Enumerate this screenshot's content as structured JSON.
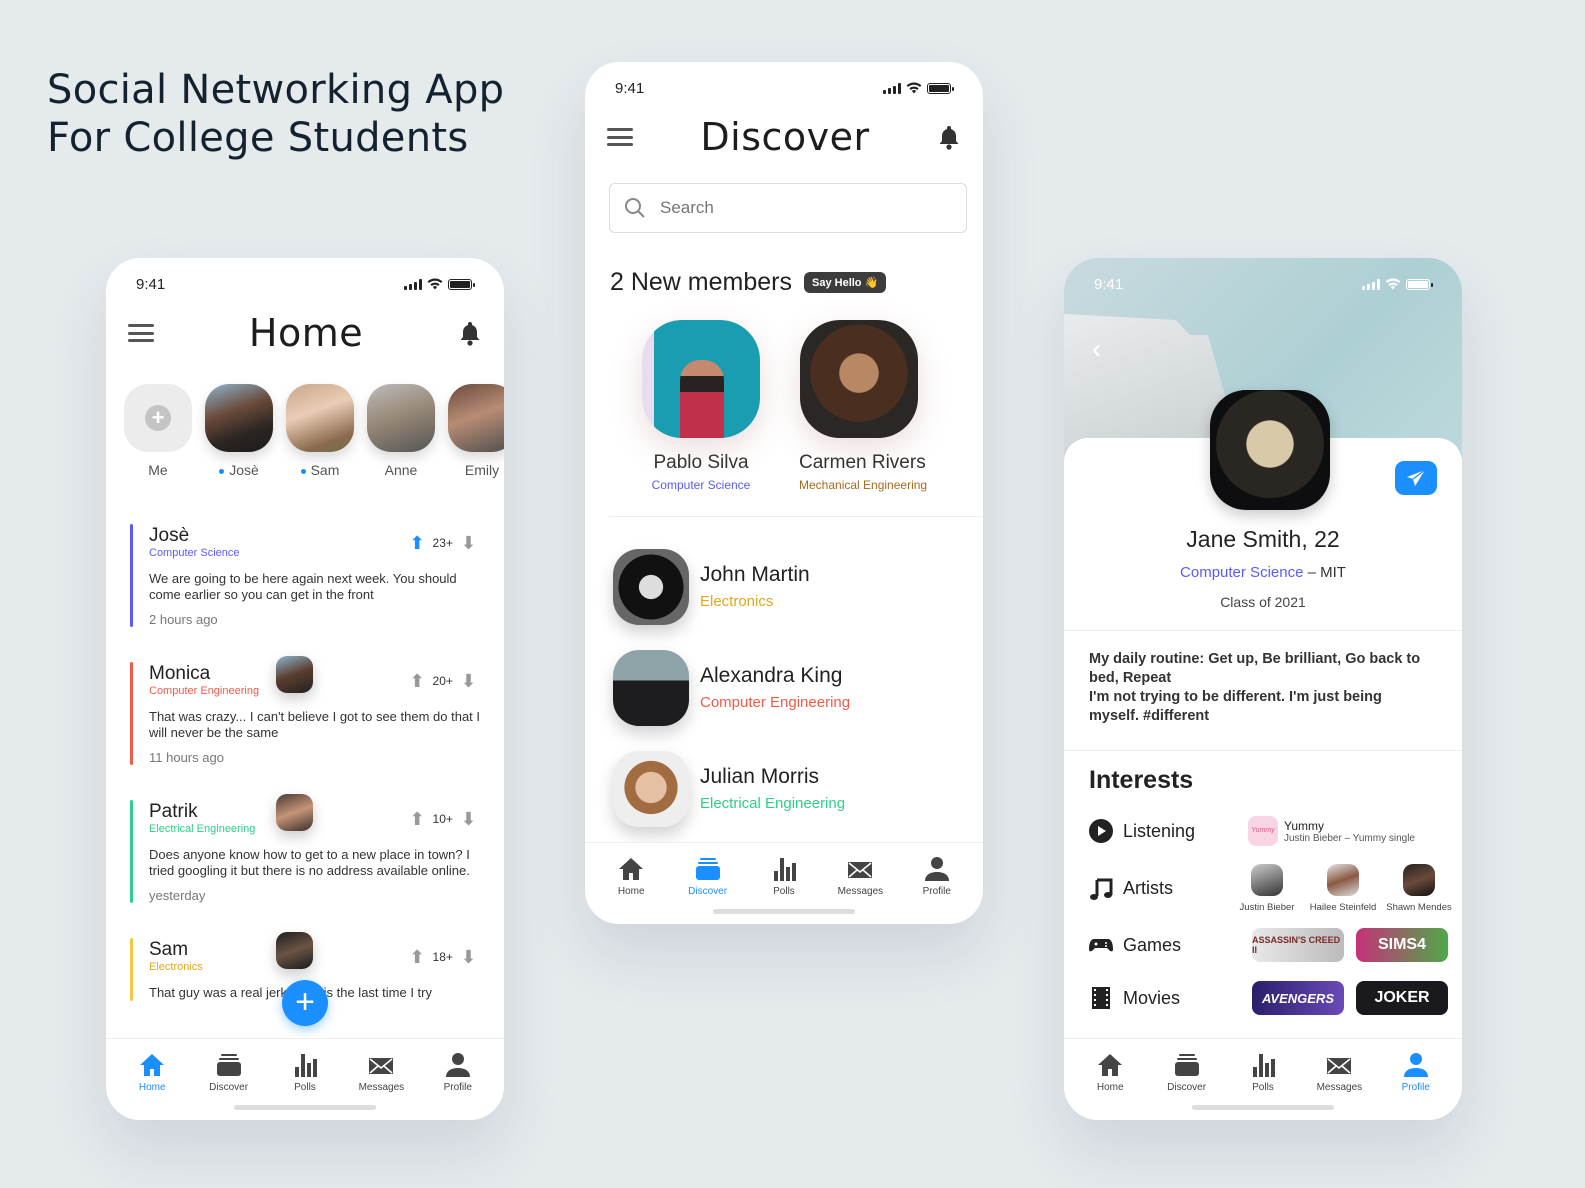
{
  "headline": {
    "line1": "Social Networking App",
    "line2": "For College Students"
  },
  "status_time": "9:41",
  "colors": {
    "accent": "#1c8fff",
    "cs": "#5b5bf5",
    "ce": "#f25a47",
    "ee": "#2ecf8a",
    "el": "#e0a81c",
    "me": "#a86a1e"
  },
  "nav": [
    {
      "label": "Home",
      "icon": "home-icon"
    },
    {
      "label": "Discover",
      "icon": "cards-icon"
    },
    {
      "label": "Polls",
      "icon": "bar-chart-icon"
    },
    {
      "label": "Messages",
      "icon": "envelope-icon"
    },
    {
      "label": "Profile",
      "icon": "person-icon"
    }
  ],
  "home": {
    "title": "Home",
    "stories": [
      {
        "name": "Me",
        "online": false
      },
      {
        "name": "Josè",
        "online": true
      },
      {
        "name": "Sam",
        "online": true
      },
      {
        "name": "Anne",
        "online": false
      },
      {
        "name": "Emily",
        "online": false
      }
    ],
    "posts": [
      {
        "name": "Josè",
        "major": "Computer Science",
        "votes": "23+",
        "upvoted": true,
        "text": "We are going to be here again next week. You should come earlier so you can get in the front",
        "time": "2 hours ago"
      },
      {
        "name": "Monica",
        "major": "Computer Engineering",
        "votes": "20+",
        "upvoted": false,
        "text": "That was crazy... I can't believe I got to see them do that I will never be the same",
        "time": "11 hours ago"
      },
      {
        "name": "Patrik",
        "major": "Electrical Engineering",
        "votes": "10+",
        "upvoted": false,
        "text": "Does anyone know how to get to a new place in town? I tried googling it but there is no address available online.",
        "time": "yesterday"
      },
      {
        "name": "Sam",
        "major": "Electronics",
        "votes": "18+",
        "upvoted": false,
        "text": "That guy was a real jerk. That is the last time I try",
        "time": ""
      }
    ],
    "fab": "+"
  },
  "discover": {
    "title": "Discover",
    "search_placeholder": "Search",
    "new_members_heading": "2 New members",
    "say_hello": "Say Hello 👋",
    "new_members": [
      {
        "name": "Pablo Silva",
        "major": "Computer Science"
      },
      {
        "name": "Carmen Rivers",
        "major": "Mechanical Engineering"
      }
    ],
    "members": [
      {
        "name": "John Martin",
        "major": "Electronics"
      },
      {
        "name": "Alexandra King",
        "major": "Computer Engineering"
      },
      {
        "name": "Julian Morris",
        "major": "Electrical Engineering"
      }
    ]
  },
  "profile": {
    "name": "Jane Smith, 22",
    "major": "Computer Science",
    "school": " – MIT",
    "class": "Class of 2021",
    "bio": "My daily routine: Get up, Be brilliant, Go back to bed, Repeat\nI'm not trying to be different. I'm just being myself. #different",
    "interests_heading": "Interests",
    "listening": {
      "label": "Listening",
      "cover": "Yummy",
      "title": "Yummy",
      "subtitle": "Justin Bieber – Yummy single"
    },
    "artists": {
      "label": "Artists",
      "items": [
        "Justin Bieber",
        "Hailee Steinfeld",
        "Shawn Mendes"
      ]
    },
    "games": {
      "label": "Games",
      "items": [
        "ASSASSIN'S CREED II",
        "SIMS4"
      ]
    },
    "movies": {
      "label": "Movies",
      "items": [
        "AVENGERS",
        "JOKER"
      ]
    }
  }
}
